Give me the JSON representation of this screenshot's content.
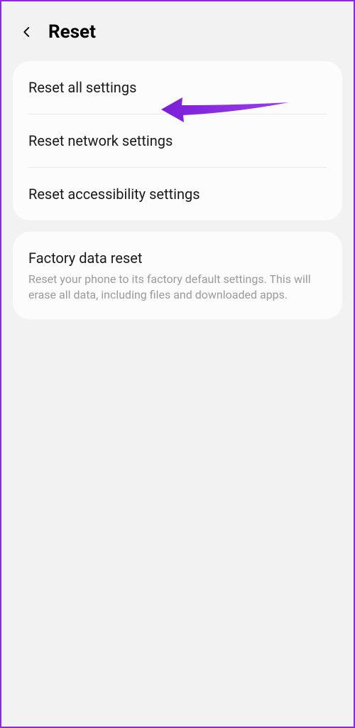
{
  "header": {
    "title": "Reset"
  },
  "group1": {
    "items": [
      {
        "title": "Reset all settings"
      },
      {
        "title": "Reset network settings"
      },
      {
        "title": "Reset accessibility settings"
      }
    ]
  },
  "group2": {
    "items": [
      {
        "title": "Factory data reset",
        "subtitle": "Reset your phone to its factory default settings. This will erase all data, including files and downloaded apps."
      }
    ]
  }
}
